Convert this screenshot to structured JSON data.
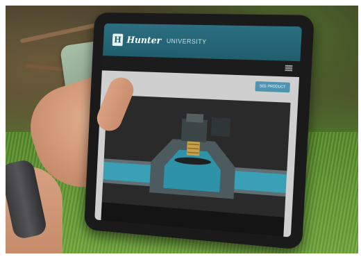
{
  "app": {
    "logo_letter": "H",
    "brand_name": "Hunter",
    "brand_sub": "UNIVERSITY"
  },
  "toolbar": {
    "action_label": "SEE PRODUCT"
  },
  "icons": {
    "menu": "hamburger-menu-icon",
    "logo": "hunter-logo-icon"
  },
  "colors": {
    "header": "#1f5e6d",
    "action_button": "#4e93b0",
    "grass": "#6fa33e"
  }
}
